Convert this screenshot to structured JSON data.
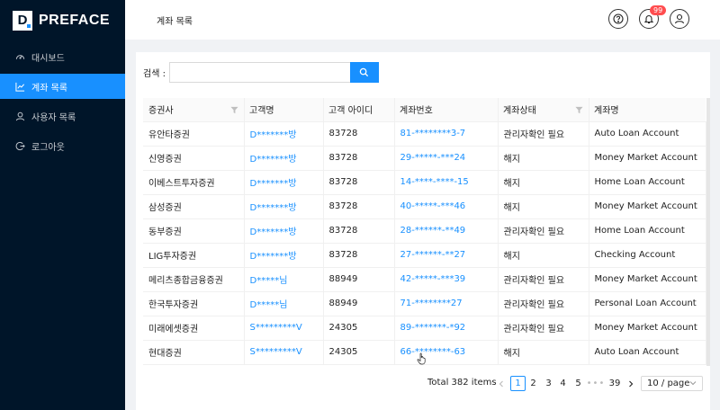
{
  "brand": {
    "logo_letter": "D",
    "name": "PREFACE",
    "accent": "#1890ff"
  },
  "sidebar": {
    "items": [
      {
        "label": "대시보드",
        "icon": "dashboard-icon"
      },
      {
        "label": "계좌 목록",
        "icon": "line-chart-icon",
        "active": true
      },
      {
        "label": "사용자 목록",
        "icon": "user-icon"
      },
      {
        "label": "로그아웃",
        "icon": "logout-icon"
      }
    ]
  },
  "header": {
    "title": "계좌 목록",
    "notification_count": "99"
  },
  "search": {
    "label": "검색 :",
    "value": "",
    "placeholder": ""
  },
  "table": {
    "columns": [
      "증권사",
      "고객명",
      "고객 아이디",
      "계좌번호",
      "계좌상태",
      "계좌명"
    ],
    "rows": [
      [
        "유안타증권",
        "D*******방",
        "83728",
        "81-********3-7",
        "관리자확인 필요",
        "Auto Loan Account"
      ],
      [
        "신영증권",
        "D*******방",
        "83728",
        "29-*****-***24",
        "해지",
        "Money Market Account"
      ],
      [
        "이베스트투자증권",
        "D*******방",
        "83728",
        "14-****-****-15",
        "해지",
        "Home Loan Account"
      ],
      [
        "삼성증권",
        "D*******방",
        "83728",
        "40-*****-***46",
        "해지",
        "Money Market Account"
      ],
      [
        "동부증권",
        "D*******방",
        "83728",
        "28-******-**49",
        "관리자확인 필요",
        "Home Loan Account"
      ],
      [
        "LIG투자증권",
        "D*******방",
        "83728",
        "27-******-**27",
        "해지",
        "Checking Account"
      ],
      [
        "메리츠종합금융증권",
        "D*****님",
        "88949",
        "42-*****-***39",
        "관리자확인 필요",
        "Money Market Account"
      ],
      [
        "한국투자증권",
        "D*****님",
        "88949",
        "71-********27",
        "관리자확인 필요",
        "Personal Loan Account"
      ],
      [
        "미래에셋증권",
        "S*********V",
        "24305",
        "89-*******-*92",
        "관리자확인 필요",
        "Money Market Account"
      ],
      [
        "현대증권",
        "S*********V",
        "24305",
        "66-********-63",
        "해지",
        "Auto Loan Account"
      ]
    ]
  },
  "pagination": {
    "total": "Total 382 items",
    "pages": [
      "1",
      "2",
      "3",
      "4",
      "5"
    ],
    "ellipsis": "•••",
    "last": "39",
    "current": "1",
    "page_size": "10 / page"
  }
}
